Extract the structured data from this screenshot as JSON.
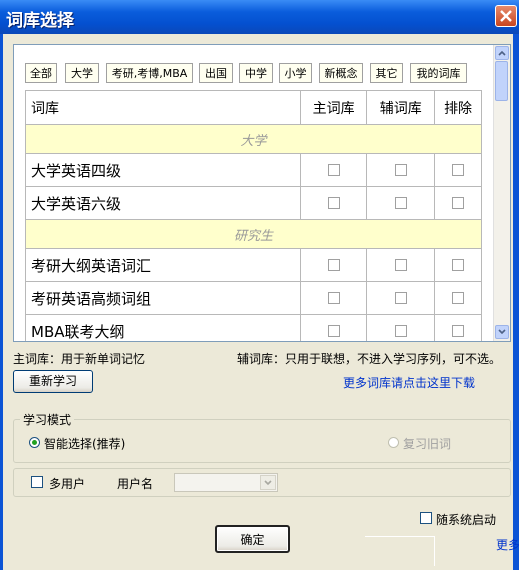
{
  "window": {
    "title": "词库选择"
  },
  "categories": [
    "全部",
    "大学",
    "考研,考博,MBA",
    "出国",
    "中学",
    "小学",
    "新概念",
    "其它",
    "我的词库"
  ],
  "table": {
    "headers": {
      "name": "词库",
      "main": "主词库",
      "aux": "辅词库",
      "exclude": "排除"
    },
    "groups": [
      {
        "label": "大学",
        "rows": [
          "大学英语四级",
          "大学英语六级"
        ]
      },
      {
        "label": "研究生",
        "rows": [
          "考研大纲英语词汇",
          "考研英语高频词组",
          "MBA联考大纲"
        ]
      }
    ]
  },
  "info": {
    "main_desc": "主词库：用于新单词记忆",
    "aux_desc": "辅词库：只用于联想，不进入学习序列，可不选。",
    "relearn_button": "重新学习",
    "download_link": "更多词库请点击这里下载"
  },
  "study_mode": {
    "legend": "学习模式",
    "options": [
      {
        "label": "智能选择(推荐)",
        "selected": true
      },
      {
        "label": "复习旧词",
        "selected": false,
        "disabled": true
      }
    ]
  },
  "user": {
    "multi_user_label": "多用户",
    "username_label": "用户名",
    "username_value": ""
  },
  "startup": {
    "label": "随系统启动"
  },
  "footer": {
    "ok_button": "确定",
    "more_link": "更多"
  },
  "colors": {
    "titlebar": "#0a5ddc",
    "group_row": "#ffffcc",
    "link": "#0033cc"
  }
}
